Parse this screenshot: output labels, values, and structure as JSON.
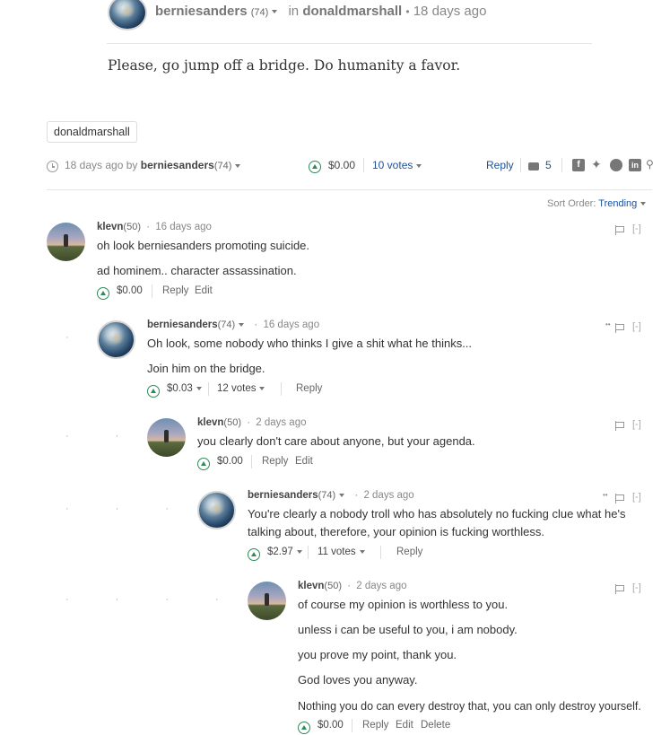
{
  "post": {
    "author": "berniesanders",
    "author_rep": "(74)",
    "in_label": "in",
    "community": "donaldmarshall",
    "bullet": "•",
    "time": "18 days ago",
    "body": "Please, go jump off a bridge. Do humanity a favor."
  },
  "tags": [
    "donaldmarshall"
  ],
  "footer": {
    "time": "18 days ago",
    "by": "by",
    "author": "berniesanders",
    "rep": "(74)",
    "payout": "$0.00",
    "votes": "10 votes",
    "reply": "Reply",
    "replies": "5",
    "sort_label": "Sort Order:",
    "sort_value": "Trending"
  },
  "icons": {
    "clock": "clock-icon",
    "upvote": "upvote-icon",
    "comments": "comments-icon",
    "facebook": "facebook-icon",
    "twitter": "twitter-icon",
    "reddit": "reddit-icon",
    "linkedin": "linkedin-icon",
    "link": "link-icon",
    "flag": "flag-icon"
  },
  "comments": [
    {
      "author": "klevn",
      "rep": "(50)",
      "time": "16 days ago",
      "collapse": "[-]",
      "lines": [
        "oh look berniesanders promoting suicide.",
        "ad hominem.. character assassination."
      ],
      "payout": "$0.00",
      "votes": "",
      "reply": "Reply",
      "edit": "Edit"
    },
    {
      "author": "berniesanders",
      "rep": "(74)",
      "time": "16 days ago",
      "collapse": "[-]",
      "lines": [
        "Oh look, some nobody who thinks I give a shit what he thinks...",
        "Join him on the bridge."
      ],
      "payout": "$0.03",
      "votes": "12 votes",
      "reply": "Reply"
    },
    {
      "author": "klevn",
      "rep": "(50)",
      "time": "2 days ago",
      "collapse": "[-]",
      "lines": [
        "you clearly don't care about anyone, but your agenda."
      ],
      "payout": "$0.00",
      "reply": "Reply",
      "edit": "Edit"
    },
    {
      "author": "berniesanders",
      "rep": "(74)",
      "time": "2 days ago",
      "collapse": "[-]",
      "lines": [
        "You're clearly a nobody troll who has absolutely no fucking clue what he's",
        "talking about, therefore, your opinion is fucking worthless."
      ],
      "payout": "$2.97",
      "votes": "11 votes",
      "reply": "Reply"
    },
    {
      "author": "klevn",
      "rep": "(50)",
      "time": "2 days ago",
      "collapse": "[-]",
      "lines": [
        "of course my opinion is worthless to you.",
        "unless i can be useful to you, i am nobody.",
        "you prove my point, thank you.",
        "God loves you anyway.",
        "Nothing you do can every destroy that, you can only destroy yourself."
      ],
      "payout": "$0.00",
      "reply": "Reply",
      "edit": "Edit",
      "delete": "Delete"
    }
  ],
  "separator": "·",
  "more": "••"
}
